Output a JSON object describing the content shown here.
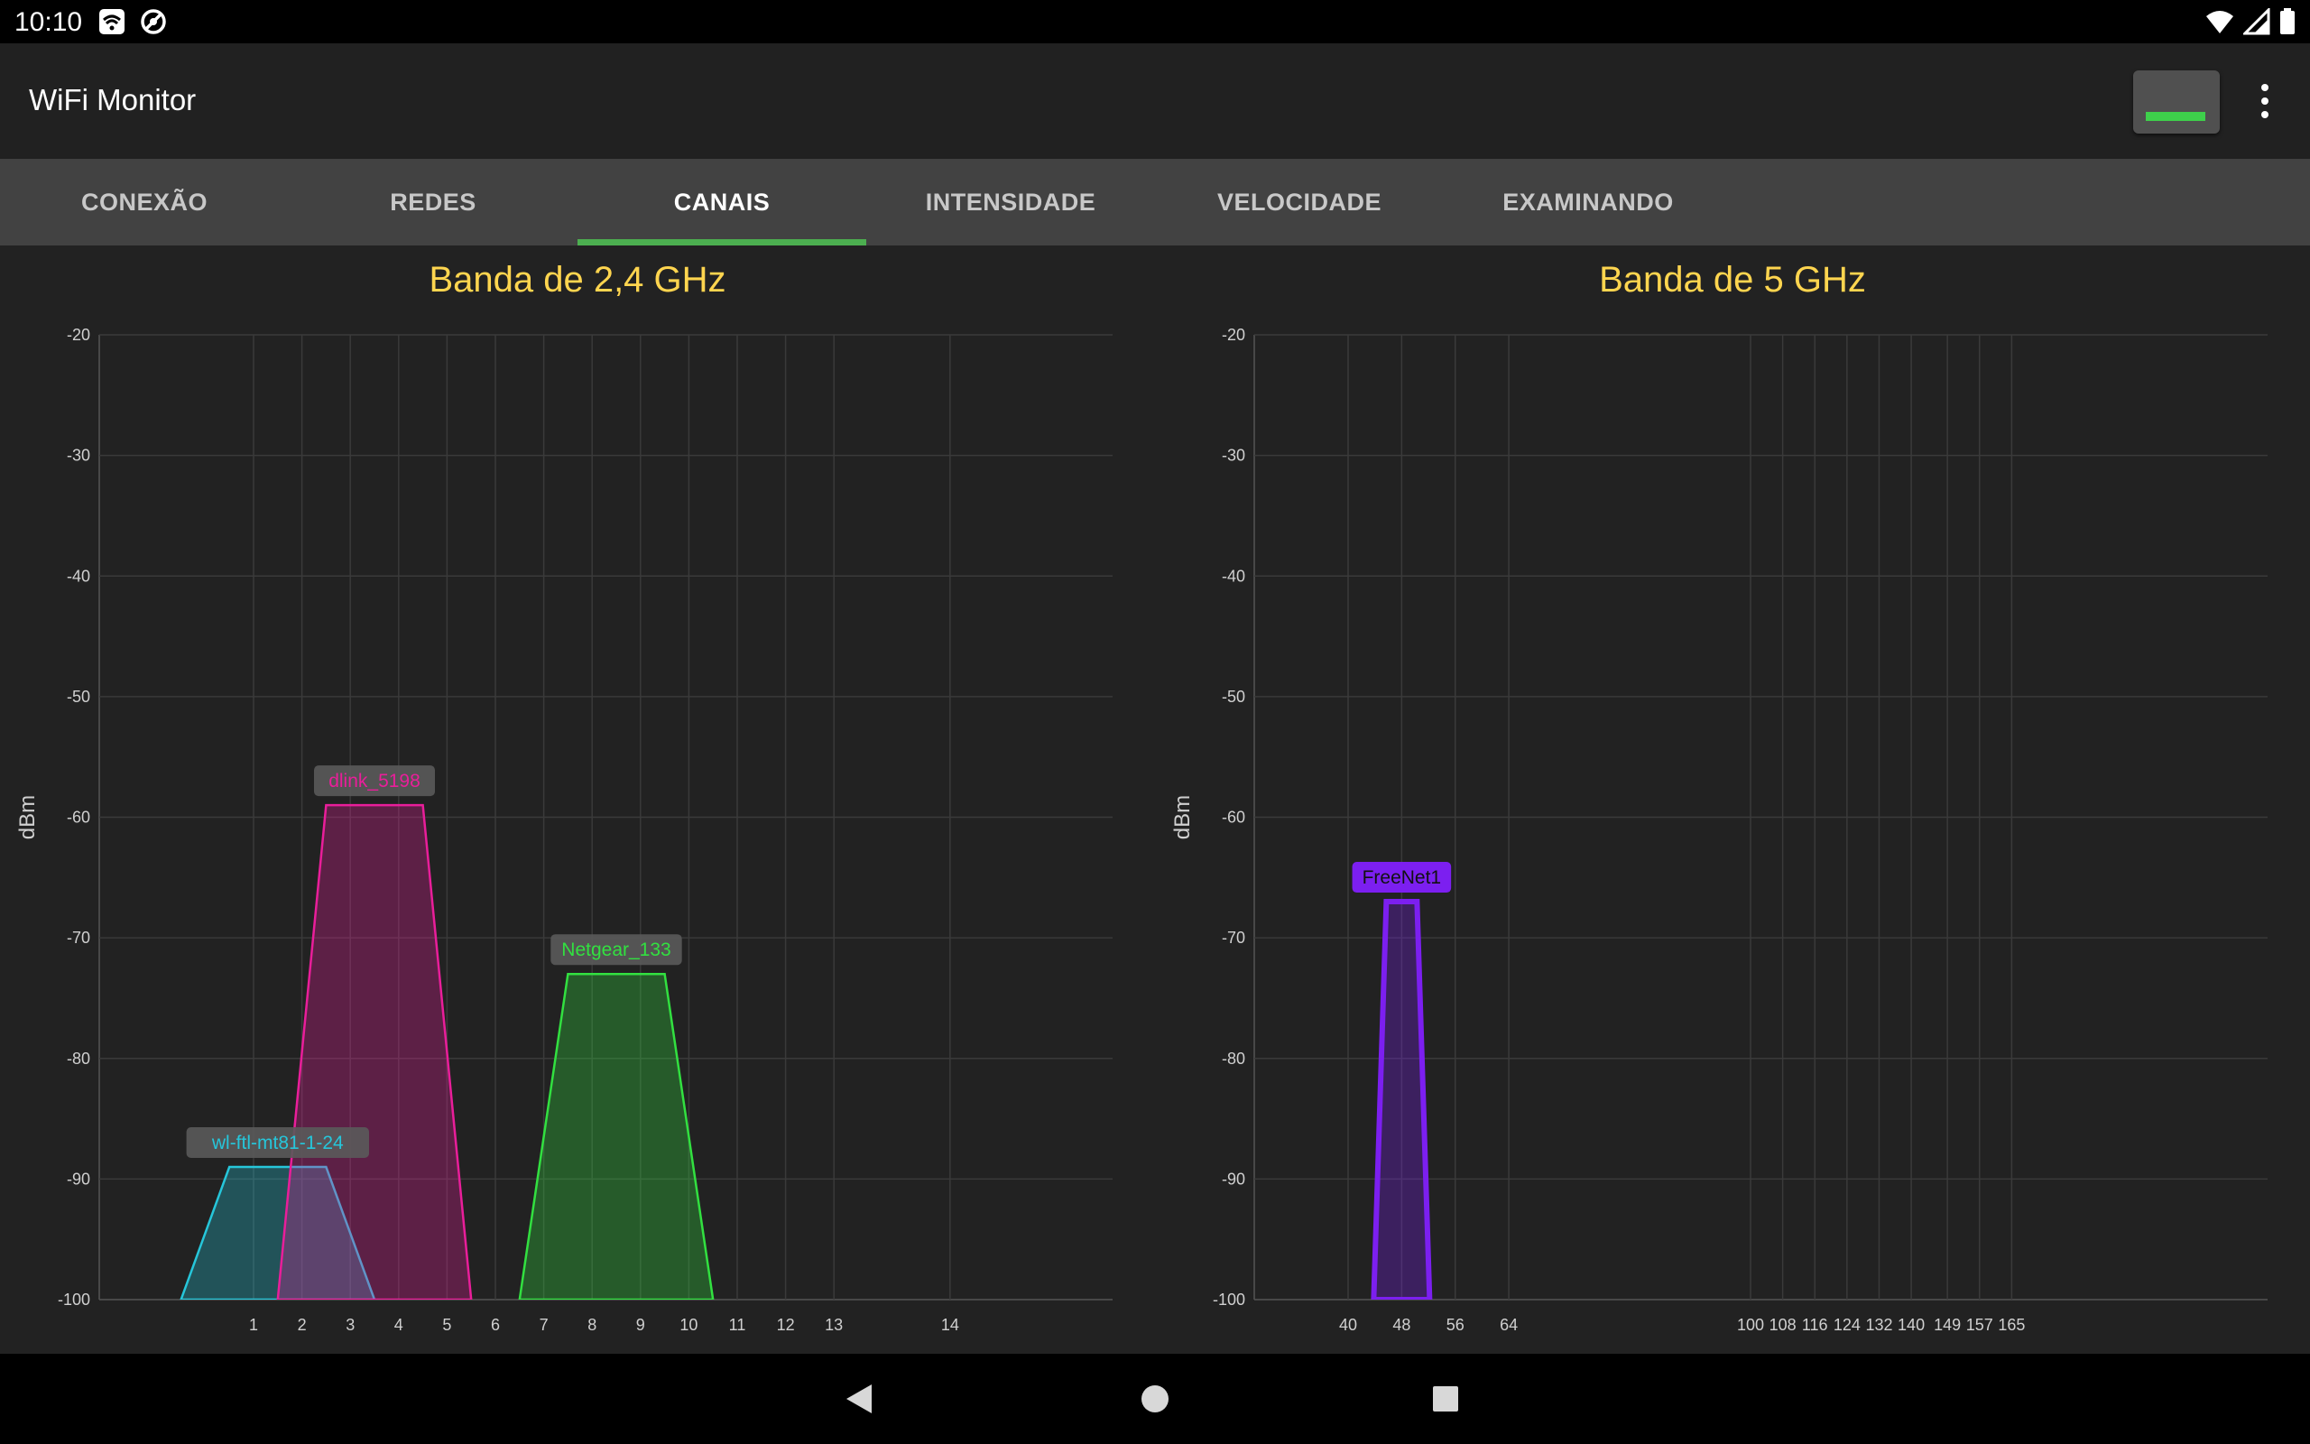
{
  "status_bar": {
    "time": "10:10",
    "left_icons": [
      "wifi-box-icon",
      "no-entry-icon"
    ],
    "right_icons": [
      "wifi-signal-icon",
      "cell-signal-icon",
      "battery-icon"
    ]
  },
  "app_bar": {
    "title": "WiFi Monitor",
    "scan_button_icon": "scan-indicator-icon",
    "menu_icon": "more-vert-icon"
  },
  "tabs": [
    {
      "label": "CONEXÃO",
      "active": false
    },
    {
      "label": "REDES",
      "active": false
    },
    {
      "label": "CANAIS",
      "active": true
    },
    {
      "label": "INTENSIDADE",
      "active": false
    },
    {
      "label": "VELOCIDADE",
      "active": false
    },
    {
      "label": "EXAMINANDO",
      "active": false
    }
  ],
  "colors": {
    "accent": "#4caf50",
    "title_color": "#ffd54f",
    "grid": "#3a3a3a",
    "axis_text": "#d0d0d0"
  },
  "chart_data": [
    {
      "type": "area",
      "title": "Banda de 2,4 GHz",
      "ylabel": "dBm",
      "xlabel": "",
      "ylim": [
        -100,
        -20
      ],
      "yticks": [
        -20,
        -30,
        -40,
        -50,
        -60,
        -70,
        -80,
        -90,
        -100
      ],
      "xlim": [
        -2.2,
        17
      ],
      "xticks": [
        "1",
        "2",
        "3",
        "4",
        "5",
        "6",
        "7",
        "8",
        "9",
        "10",
        "11",
        "12",
        "13",
        "14"
      ],
      "grid": true,
      "series": [
        {
          "name": "wl-ftl-mt81-1-24",
          "channel": 1,
          "width_channels": 4,
          "dbm": -89,
          "color": "#26c6da"
        },
        {
          "name": "dlink_5198",
          "channel": 3,
          "width_channels": 4,
          "dbm": -59,
          "color": "#e91e9a"
        },
        {
          "name": "Netgear_133",
          "channel": 8,
          "width_channels": 4,
          "dbm": -73,
          "color": "#32e040"
        }
      ]
    },
    {
      "type": "area",
      "title": "Banda de 5 GHz",
      "ylabel": "dBm",
      "xlabel": "",
      "ylim": [
        -100,
        -20
      ],
      "yticks": [
        -20,
        -30,
        -40,
        -50,
        -60,
        -70,
        -80,
        -90,
        -100
      ],
      "xticks": [
        "40",
        "48",
        "56",
        "64",
        "100",
        "108",
        "116",
        "124",
        "132",
        "140",
        "149",
        "157",
        "165"
      ],
      "grid": true,
      "series": [
        {
          "name": "FreeNet1",
          "channel": 48,
          "width_channels": 4,
          "dbm": -67,
          "color": "#7c1ff0"
        }
      ]
    }
  ]
}
